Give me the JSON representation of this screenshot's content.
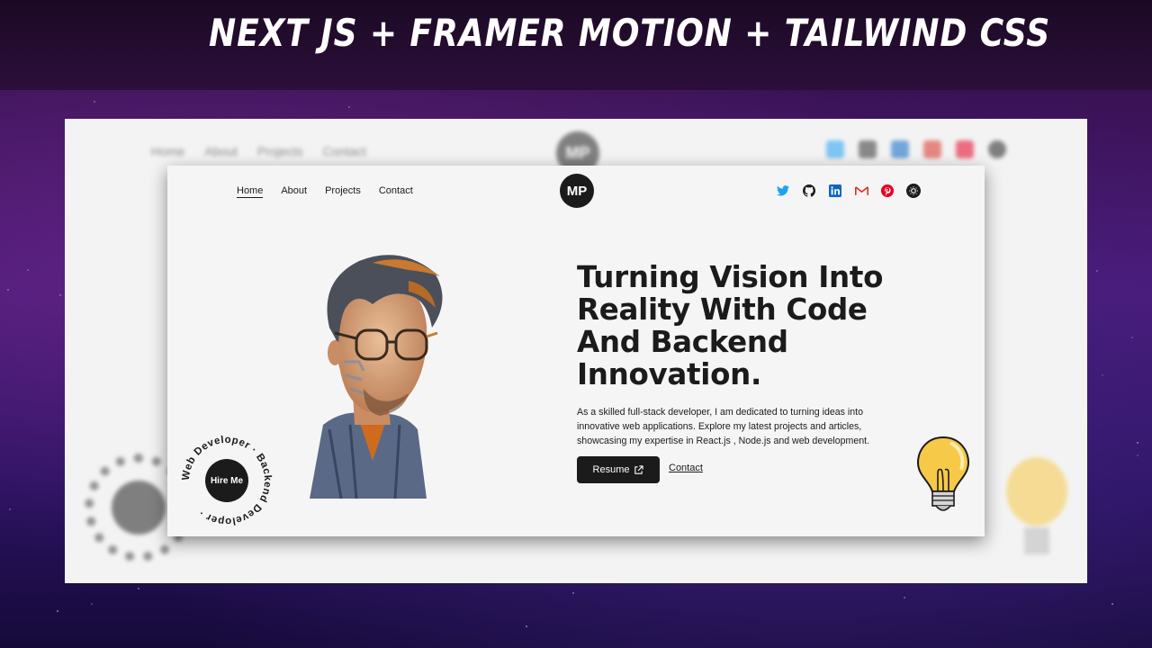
{
  "banner": {
    "title": "Next JS  + Framer Motion + Tailwind CSS"
  },
  "nav": {
    "items": [
      "Home",
      "About",
      "Projects",
      "Contact"
    ],
    "active": "Home"
  },
  "logo": {
    "initials": "MP"
  },
  "socials": [
    "twitter-icon",
    "github-icon",
    "linkedin-icon",
    "gmail-icon",
    "pinterest-icon",
    "theme-toggle-icon"
  ],
  "hero": {
    "headline_lines": [
      "Turning Vision Into",
      "Reality With Code",
      "And Backend",
      "Innovation."
    ],
    "description_lines": [
      "As a skilled full-stack developer, I am dedicated to turning ideas into",
      "innovative web applications. Explore my latest projects and articles,",
      "showcasing my expertise in React.js , Node.js and web development."
    ],
    "resume_label": "Resume",
    "contact_label": "Contact"
  },
  "hire": {
    "label": "Hire Me",
    "ring_text": "Web Developer · Backend Developer · "
  },
  "colors": {
    "dark": "#1b1b1b",
    "twitter": "#1da1f2",
    "linkedin": "#0a66c2",
    "gmail": "#d93025",
    "pinterest": "#e60023",
    "bulb": "#f7c948"
  }
}
